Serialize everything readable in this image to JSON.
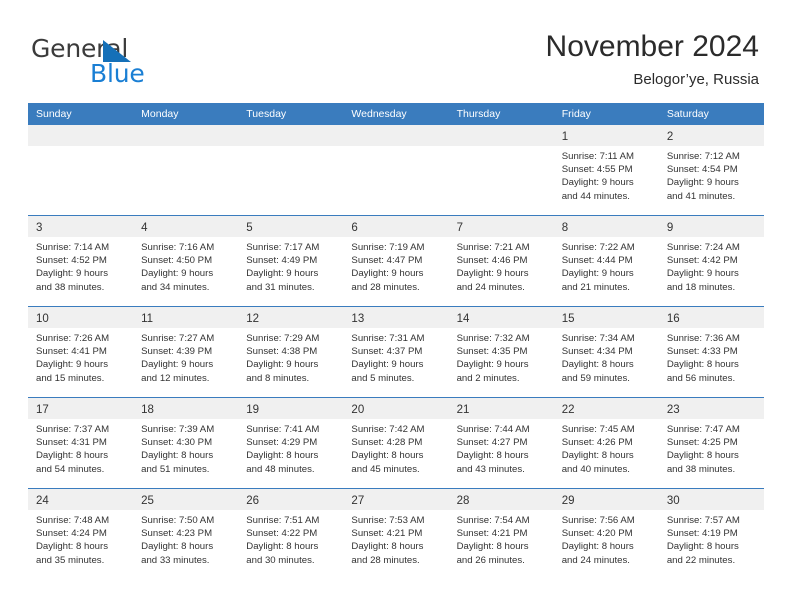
{
  "brand": {
    "name_top": "General",
    "name_bottom": "Blue",
    "triangle_icon": "triangle-icon",
    "color_top": "#3b3b3b",
    "color_bottom": "#1a7fd4"
  },
  "header": {
    "title": "November 2024",
    "subtitle": "Belogor’ye, Russia"
  },
  "theme": {
    "header_bg": "#3a7cbe",
    "header_text": "#ffffff",
    "daynum_band_bg": "#f0f0f0",
    "cell_bg": "#ffffff",
    "grid_line": "#3a7cbe",
    "body_text": "#333333"
  },
  "weekday_headers": [
    "Sunday",
    "Monday",
    "Tuesday",
    "Wednesday",
    "Thursday",
    "Friday",
    "Saturday"
  ],
  "weeks": [
    [
      {
        "day": "",
        "lines": []
      },
      {
        "day": "",
        "lines": []
      },
      {
        "day": "",
        "lines": []
      },
      {
        "day": "",
        "lines": []
      },
      {
        "day": "",
        "lines": []
      },
      {
        "day": "1",
        "lines": [
          "Sunrise: 7:11 AM",
          "Sunset: 4:55 PM",
          "Daylight: 9 hours",
          "and 44 minutes."
        ]
      },
      {
        "day": "2",
        "lines": [
          "Sunrise: 7:12 AM",
          "Sunset: 4:54 PM",
          "Daylight: 9 hours",
          "and 41 minutes."
        ]
      }
    ],
    [
      {
        "day": "3",
        "lines": [
          "Sunrise: 7:14 AM",
          "Sunset: 4:52 PM",
          "Daylight: 9 hours",
          "and 38 minutes."
        ]
      },
      {
        "day": "4",
        "lines": [
          "Sunrise: 7:16 AM",
          "Sunset: 4:50 PM",
          "Daylight: 9 hours",
          "and 34 minutes."
        ]
      },
      {
        "day": "5",
        "lines": [
          "Sunrise: 7:17 AM",
          "Sunset: 4:49 PM",
          "Daylight: 9 hours",
          "and 31 minutes."
        ]
      },
      {
        "day": "6",
        "lines": [
          "Sunrise: 7:19 AM",
          "Sunset: 4:47 PM",
          "Daylight: 9 hours",
          "and 28 minutes."
        ]
      },
      {
        "day": "7",
        "lines": [
          "Sunrise: 7:21 AM",
          "Sunset: 4:46 PM",
          "Daylight: 9 hours",
          "and 24 minutes."
        ]
      },
      {
        "day": "8",
        "lines": [
          "Sunrise: 7:22 AM",
          "Sunset: 4:44 PM",
          "Daylight: 9 hours",
          "and 21 minutes."
        ]
      },
      {
        "day": "9",
        "lines": [
          "Sunrise: 7:24 AM",
          "Sunset: 4:42 PM",
          "Daylight: 9 hours",
          "and 18 minutes."
        ]
      }
    ],
    [
      {
        "day": "10",
        "lines": [
          "Sunrise: 7:26 AM",
          "Sunset: 4:41 PM",
          "Daylight: 9 hours",
          "and 15 minutes."
        ]
      },
      {
        "day": "11",
        "lines": [
          "Sunrise: 7:27 AM",
          "Sunset: 4:39 PM",
          "Daylight: 9 hours",
          "and 12 minutes."
        ]
      },
      {
        "day": "12",
        "lines": [
          "Sunrise: 7:29 AM",
          "Sunset: 4:38 PM",
          "Daylight: 9 hours",
          "and 8 minutes."
        ]
      },
      {
        "day": "13",
        "lines": [
          "Sunrise: 7:31 AM",
          "Sunset: 4:37 PM",
          "Daylight: 9 hours",
          "and 5 minutes."
        ]
      },
      {
        "day": "14",
        "lines": [
          "Sunrise: 7:32 AM",
          "Sunset: 4:35 PM",
          "Daylight: 9 hours",
          "and 2 minutes."
        ]
      },
      {
        "day": "15",
        "lines": [
          "Sunrise: 7:34 AM",
          "Sunset: 4:34 PM",
          "Daylight: 8 hours",
          "and 59 minutes."
        ]
      },
      {
        "day": "16",
        "lines": [
          "Sunrise: 7:36 AM",
          "Sunset: 4:33 PM",
          "Daylight: 8 hours",
          "and 56 minutes."
        ]
      }
    ],
    [
      {
        "day": "17",
        "lines": [
          "Sunrise: 7:37 AM",
          "Sunset: 4:31 PM",
          "Daylight: 8 hours",
          "and 54 minutes."
        ]
      },
      {
        "day": "18",
        "lines": [
          "Sunrise: 7:39 AM",
          "Sunset: 4:30 PM",
          "Daylight: 8 hours",
          "and 51 minutes."
        ]
      },
      {
        "day": "19",
        "lines": [
          "Sunrise: 7:41 AM",
          "Sunset: 4:29 PM",
          "Daylight: 8 hours",
          "and 48 minutes."
        ]
      },
      {
        "day": "20",
        "lines": [
          "Sunrise: 7:42 AM",
          "Sunset: 4:28 PM",
          "Daylight: 8 hours",
          "and 45 minutes."
        ]
      },
      {
        "day": "21",
        "lines": [
          "Sunrise: 7:44 AM",
          "Sunset: 4:27 PM",
          "Daylight: 8 hours",
          "and 43 minutes."
        ]
      },
      {
        "day": "22",
        "lines": [
          "Sunrise: 7:45 AM",
          "Sunset: 4:26 PM",
          "Daylight: 8 hours",
          "and 40 minutes."
        ]
      },
      {
        "day": "23",
        "lines": [
          "Sunrise: 7:47 AM",
          "Sunset: 4:25 PM",
          "Daylight: 8 hours",
          "and 38 minutes."
        ]
      }
    ],
    [
      {
        "day": "24",
        "lines": [
          "Sunrise: 7:48 AM",
          "Sunset: 4:24 PM",
          "Daylight: 8 hours",
          "and 35 minutes."
        ]
      },
      {
        "day": "25",
        "lines": [
          "Sunrise: 7:50 AM",
          "Sunset: 4:23 PM",
          "Daylight: 8 hours",
          "and 33 minutes."
        ]
      },
      {
        "day": "26",
        "lines": [
          "Sunrise: 7:51 AM",
          "Sunset: 4:22 PM",
          "Daylight: 8 hours",
          "and 30 minutes."
        ]
      },
      {
        "day": "27",
        "lines": [
          "Sunrise: 7:53 AM",
          "Sunset: 4:21 PM",
          "Daylight: 8 hours",
          "and 28 minutes."
        ]
      },
      {
        "day": "28",
        "lines": [
          "Sunrise: 7:54 AM",
          "Sunset: 4:21 PM",
          "Daylight: 8 hours",
          "and 26 minutes."
        ]
      },
      {
        "day": "29",
        "lines": [
          "Sunrise: 7:56 AM",
          "Sunset: 4:20 PM",
          "Daylight: 8 hours",
          "and 24 minutes."
        ]
      },
      {
        "day": "30",
        "lines": [
          "Sunrise: 7:57 AM",
          "Sunset: 4:19 PM",
          "Daylight: 8 hours",
          "and 22 minutes."
        ]
      }
    ]
  ]
}
